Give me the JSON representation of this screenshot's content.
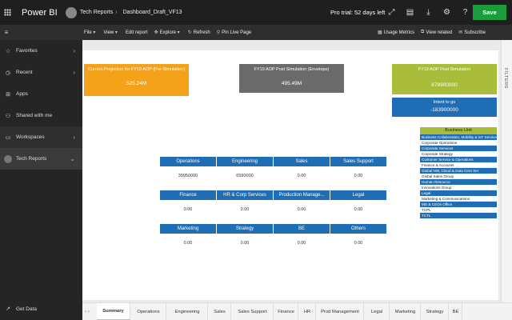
{
  "app": {
    "brand": "Power BI",
    "workspace": "Tech Reports",
    "report_name": "Dashboard_Draft_VF13",
    "trial": "Pro trial: 52 days left",
    "save_label": "Save",
    "icons": [
      "expand-icon",
      "feedback-icon",
      "download-icon",
      "settings-icon",
      "help-icon"
    ]
  },
  "toolbar": {
    "left": [
      {
        "label": "File",
        "icon": "chevron-down"
      },
      {
        "label": "View",
        "icon": "chevron-down"
      },
      {
        "label": "Edit report",
        "icon": ""
      },
      {
        "label": "Explore",
        "icon": "explore"
      },
      {
        "label": "Refresh",
        "icon": "refresh"
      },
      {
        "label": "Pin Live Page",
        "icon": "pin"
      }
    ],
    "right": [
      {
        "label": "Usage Metrics",
        "icon": "chart"
      },
      {
        "label": "View related",
        "icon": "related"
      },
      {
        "label": "Subscribe",
        "icon": "mail"
      }
    ]
  },
  "sidebar": {
    "items": [
      {
        "label": "Favorites",
        "icon": "star"
      },
      {
        "label": "Recent",
        "icon": "clock"
      },
      {
        "label": "Apps",
        "icon": "apps"
      },
      {
        "label": "Shared with me",
        "icon": "share"
      },
      {
        "label": "Workspaces",
        "icon": "workspace"
      },
      {
        "label": "Tech Reports",
        "icon": "avatar"
      }
    ],
    "get_data": "Get Data"
  },
  "filters_label": "FILTERS",
  "cards": {
    "current": {
      "title": "Current Projection for FY19 AOP (Pre-Simulation)",
      "value": "525.24M"
    },
    "simulated": {
      "title": "FY19 AOP Post Simulation (Envelope)",
      "value": "495.49M"
    },
    "post": {
      "title": "FY19 AOP Post Simulation",
      "value": "678900000"
    },
    "intent": {
      "title": "Intent to go",
      "value": "-183900000"
    }
  },
  "departments": [
    {
      "name": "Operations",
      "value": "39950000"
    },
    {
      "name": "Engineering",
      "value": "6590000"
    },
    {
      "name": "Sales",
      "value": "0.00"
    },
    {
      "name": "Sales Support",
      "value": "0.00"
    },
    {
      "name": "Finance",
      "value": "0.00"
    },
    {
      "name": "HR & Corp Services",
      "value": "0.00"
    },
    {
      "name": "Production Manage...",
      "value": "0.00"
    },
    {
      "name": "Legal",
      "value": "0.00"
    },
    {
      "name": "Marketing",
      "value": "0.00"
    },
    {
      "name": "Strategy",
      "value": "0.00"
    },
    {
      "name": "BE",
      "value": "0.00"
    },
    {
      "name": "Others",
      "value": "0.00"
    }
  ],
  "business_unit": {
    "title": "Business Unit",
    "items": [
      {
        "label": "Business Collaboration, Mobility & IoT Services",
        "selected": true
      },
      {
        "label": "Corporate Operations",
        "selected": false
      },
      {
        "label": "Corporate Services",
        "selected": true
      },
      {
        "label": "Corporate Strategy",
        "selected": false
      },
      {
        "label": "Customer Service & Operations",
        "selected": true
      },
      {
        "label": "Finance & Accounts",
        "selected": false
      },
      {
        "label": "Global NW, Cloud & Data Cent Ser",
        "selected": true
      },
      {
        "label": "Global Sales Group",
        "selected": false
      },
      {
        "label": "Human Resource",
        "selected": true
      },
      {
        "label": "Innovations Group",
        "selected": false
      },
      {
        "label": "Legal",
        "selected": true
      },
      {
        "label": "Marketing & Communications",
        "selected": false
      },
      {
        "label": "MD & CEOs Office",
        "selected": true
      },
      {
        "label": "TCPL",
        "selected": false
      },
      {
        "label": "TCTL",
        "selected": true
      }
    ]
  },
  "tabs": {
    "active": "Summary",
    "items": [
      "Summary",
      "Operations",
      "Engineering",
      "Sales",
      "Sales Support",
      "Finance",
      "HR",
      "Prod Management",
      "Legal",
      "Marketing",
      "Strategy",
      "BE"
    ]
  }
}
